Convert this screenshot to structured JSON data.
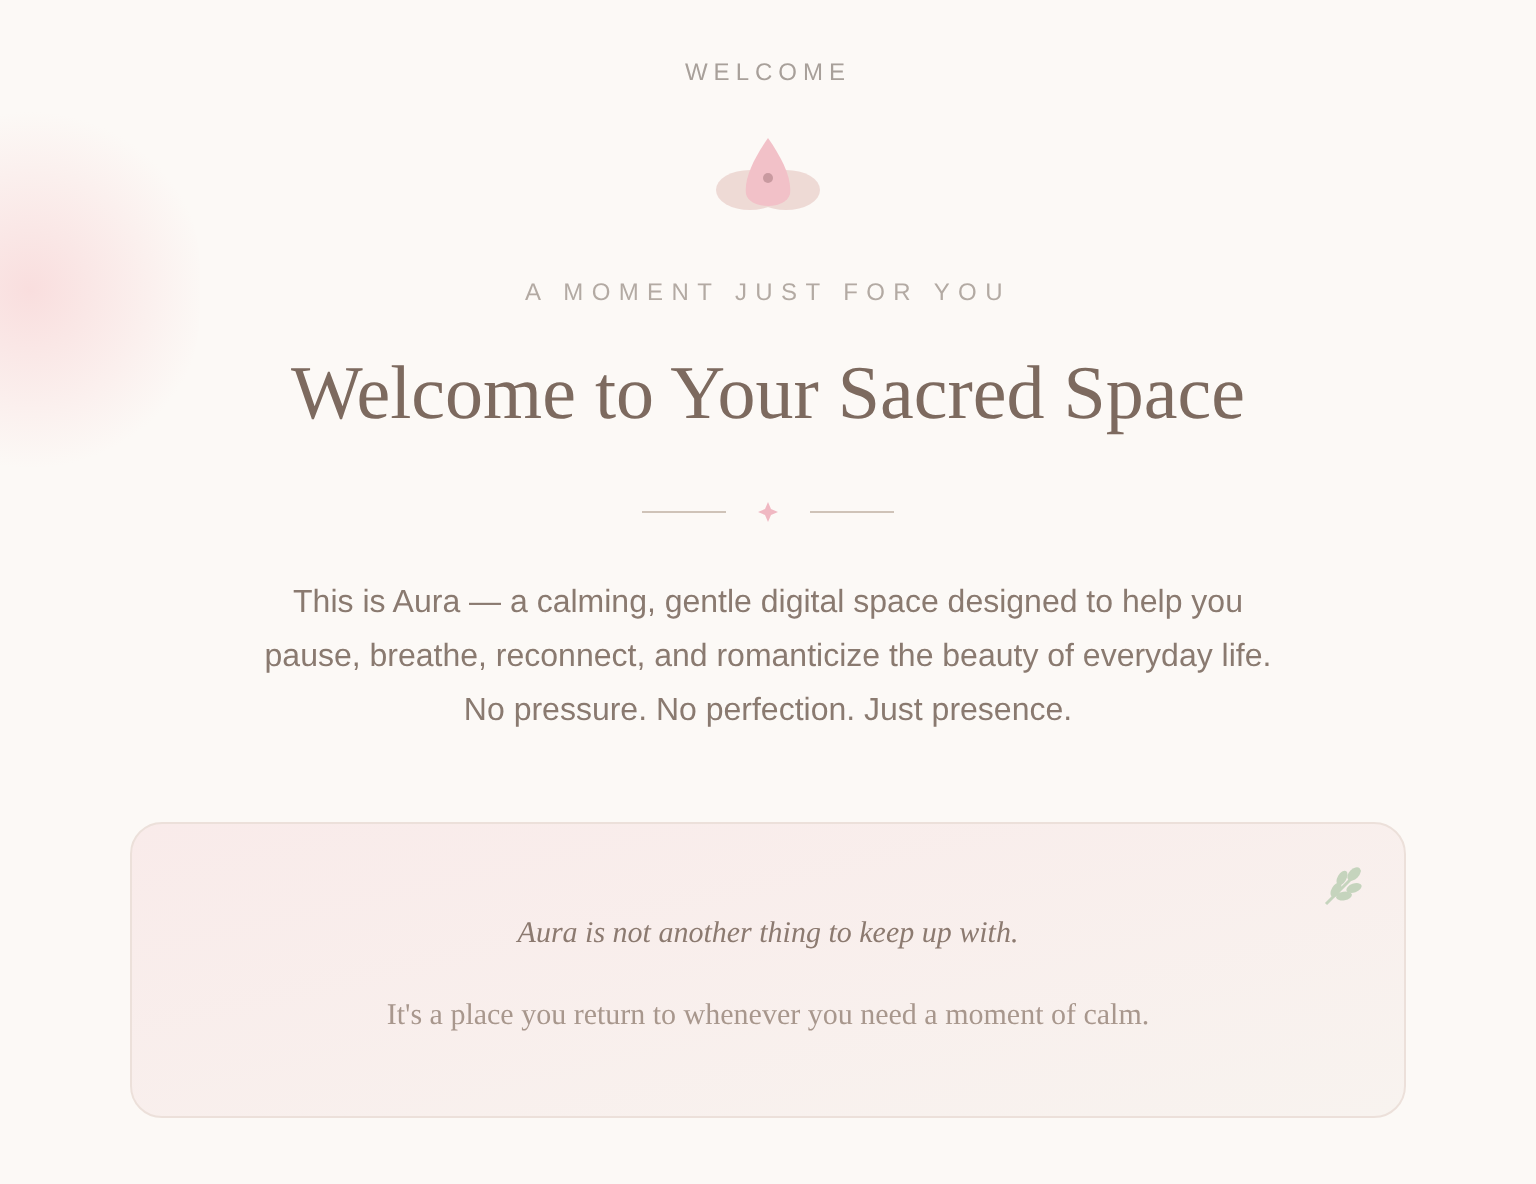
{
  "eyebrow": "WELCOME",
  "tagline": "A MOMENT JUST FOR YOU",
  "title": "Welcome to Your Sacred Space",
  "intro": "This is Aura — a calming, gentle digital space designed to help you pause, breathe, reconnect, and romanticize the beauty of everyday life. No pressure. No perfection. Just presence.",
  "card": {
    "heading": "Aura is not another thing to keep up with.",
    "body": "It's a place you return to whenever you need a moment of calm."
  }
}
